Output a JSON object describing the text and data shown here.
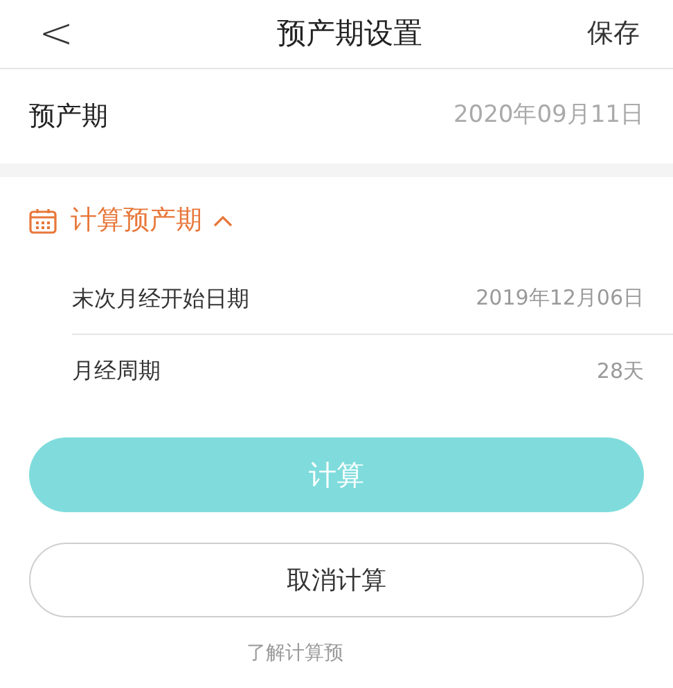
{
  "header": {
    "back": "<",
    "title": "预产期设置",
    "action": "保存"
  },
  "due_date": {
    "label": "预产期",
    "value": "2020年09月11日"
  },
  "calculator": {
    "title": "计算预产期",
    "expanded": true,
    "rows": [
      {
        "label": "末次月经开始日期",
        "value": "2019年12月06日"
      },
      {
        "label": "月经周期",
        "value": "28天"
      }
    ],
    "calculate_button": "计算",
    "cancel_button": "取消计算",
    "info_link": "了解计算预"
  }
}
